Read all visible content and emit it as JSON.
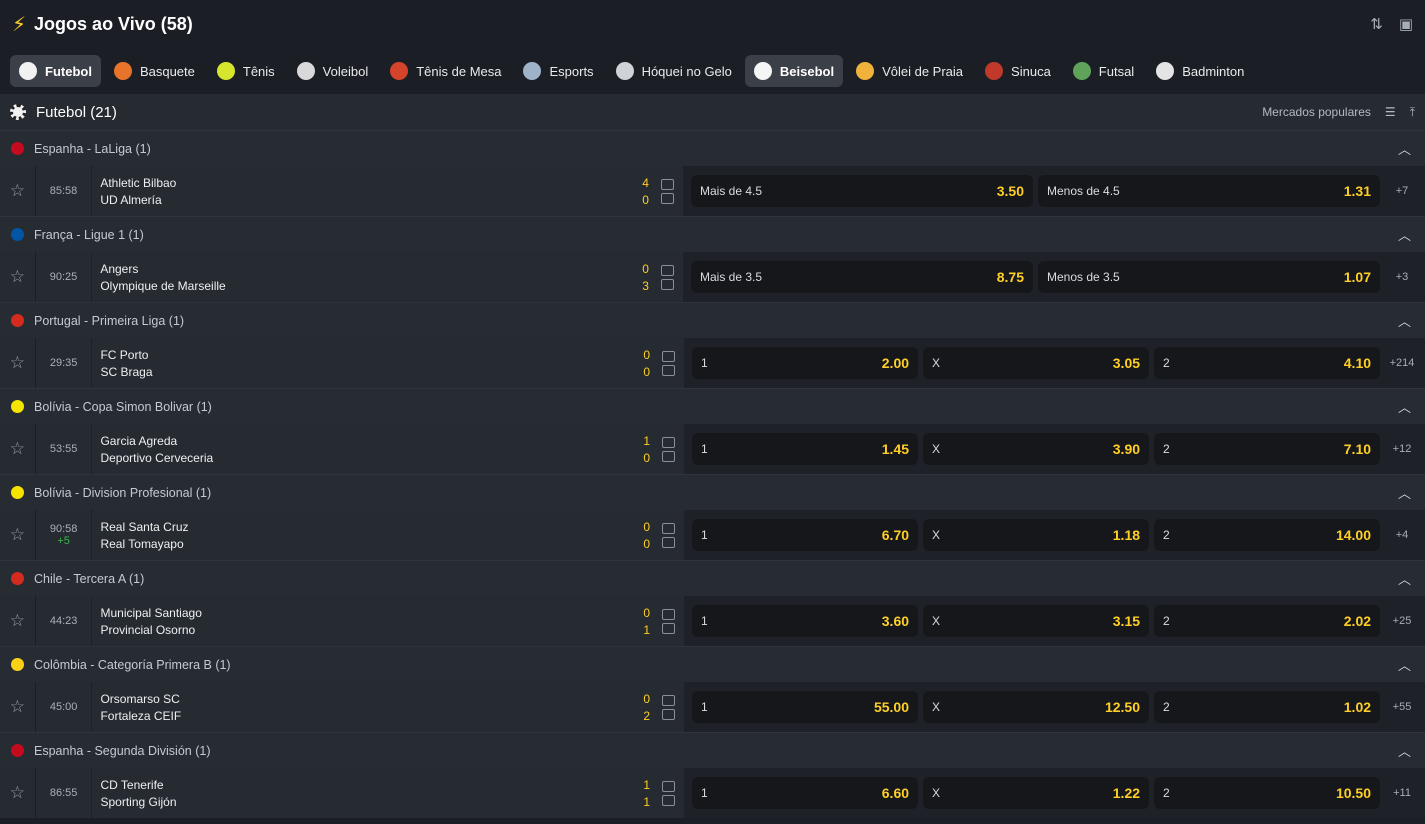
{
  "header": {
    "title": "Jogos ao Vivo (58)",
    "icons": [
      "lightning-icon",
      "sort-icon",
      "video-icon"
    ]
  },
  "sports": [
    {
      "label": "Futebol",
      "icon": "soccer-ball-icon",
      "active": true
    },
    {
      "label": "Basquete",
      "icon": "basketball-icon"
    },
    {
      "label": "Tênis",
      "icon": "tennis-ball-icon"
    },
    {
      "label": "Voleibol",
      "icon": "volleyball-icon"
    },
    {
      "label": "Tênis de Mesa",
      "icon": "table-tennis-icon"
    },
    {
      "label": "Esports",
      "icon": "gamepad-icon"
    },
    {
      "label": "Hóquei no Gelo",
      "icon": "hockey-stick-icon"
    },
    {
      "label": "Beisebol",
      "icon": "baseball-icon",
      "active": true
    },
    {
      "label": "Vôlei de Praia",
      "icon": "beach-volleyball-icon"
    },
    {
      "label": "Sinuca",
      "icon": "snooker-icon"
    },
    {
      "label": "Futsal",
      "icon": "futsal-icon"
    },
    {
      "label": "Badminton",
      "icon": "shuttlecock-icon"
    }
  ],
  "list": {
    "title": "Futebol (21)",
    "markets_label": "Mercados populares"
  },
  "leagues": [
    {
      "name": "Espanha - LaLiga (1)",
      "flag_color": "#c60b1e",
      "match": {
        "time": "85:58",
        "extra": "",
        "home": "Athletic Bilbao",
        "away": "UD Almería",
        "home_score": "4",
        "away_score": "0",
        "odds": [
          {
            "label": "Mais de 4.5",
            "value": "3.50"
          },
          {
            "label": "Menos de 4.5",
            "value": "1.31"
          }
        ],
        "more": "+7"
      }
    },
    {
      "name": "França - Ligue 1 (1)",
      "flag_color": "#0055a4",
      "match": {
        "time": "90:25",
        "extra": "",
        "home": "Angers",
        "away": "Olympique de Marseille",
        "home_score": "0",
        "away_score": "3",
        "odds": [
          {
            "label": "Mais de 3.5",
            "value": "8.75"
          },
          {
            "label": "Menos de 3.5",
            "value": "1.07"
          }
        ],
        "more": "+3"
      }
    },
    {
      "name": "Portugal - Primeira Liga (1)",
      "flag_color": "#d52b1e",
      "match": {
        "time": "29:35",
        "extra": "",
        "home": "FC Porto",
        "away": "SC Braga",
        "home_score": "0",
        "away_score": "0",
        "odds": [
          {
            "label": "1",
            "value": "2.00"
          },
          {
            "label": "X",
            "value": "3.05"
          },
          {
            "label": "2",
            "value": "4.10"
          }
        ],
        "more": "+214"
      }
    },
    {
      "name": "Bolívia - Copa Simon Bolivar (1)",
      "flag_color": "#f4e400",
      "match": {
        "time": "53:55",
        "extra": "",
        "home": "Garcia Agreda",
        "away": "Deportivo Cerveceria",
        "home_score": "1",
        "away_score": "0",
        "odds": [
          {
            "label": "1",
            "value": "1.45"
          },
          {
            "label": "X",
            "value": "3.90"
          },
          {
            "label": "2",
            "value": "7.10"
          }
        ],
        "more": "+12"
      }
    },
    {
      "name": "Bolívia - Division Profesional (1)",
      "flag_color": "#f4e400",
      "match": {
        "time": "90:58",
        "extra": "+5",
        "home": "Real Santa Cruz",
        "away": "Real Tomayapo",
        "home_score": "0",
        "away_score": "0",
        "odds": [
          {
            "label": "1",
            "value": "6.70"
          },
          {
            "label": "X",
            "value": "1.18"
          },
          {
            "label": "2",
            "value": "14.00"
          }
        ],
        "more": "+4"
      }
    },
    {
      "name": "Chile - Tercera A (1)",
      "flag_color": "#d52b1e",
      "match": {
        "time": "44:23",
        "extra": "",
        "home": "Municipal Santiago",
        "away": "Provincial Osorno",
        "home_score": "0",
        "away_score": "1",
        "odds": [
          {
            "label": "1",
            "value": "3.60"
          },
          {
            "label": "X",
            "value": "3.15"
          },
          {
            "label": "2",
            "value": "2.02"
          }
        ],
        "more": "+25"
      }
    },
    {
      "name": "Colômbia - Categoría Primera B (1)",
      "flag_color": "#fcd116",
      "match": {
        "time": "45:00",
        "extra": "",
        "home": "Orsomarso SC",
        "away": "Fortaleza CEIF",
        "home_score": "0",
        "away_score": "2",
        "odds": [
          {
            "label": "1",
            "value": "55.00"
          },
          {
            "label": "X",
            "value": "12.50"
          },
          {
            "label": "2",
            "value": "1.02"
          }
        ],
        "more": "+55"
      }
    },
    {
      "name": "Espanha - Segunda División (1)",
      "flag_color": "#c60b1e",
      "match": {
        "time": "86:55",
        "extra": "",
        "home": "CD Tenerife",
        "away": "Sporting Gijón",
        "home_score": "1",
        "away_score": "1",
        "odds": [
          {
            "label": "1",
            "value": "6.60"
          },
          {
            "label": "X",
            "value": "1.22"
          },
          {
            "label": "2",
            "value": "10.50"
          }
        ],
        "more": "+11"
      }
    }
  ]
}
